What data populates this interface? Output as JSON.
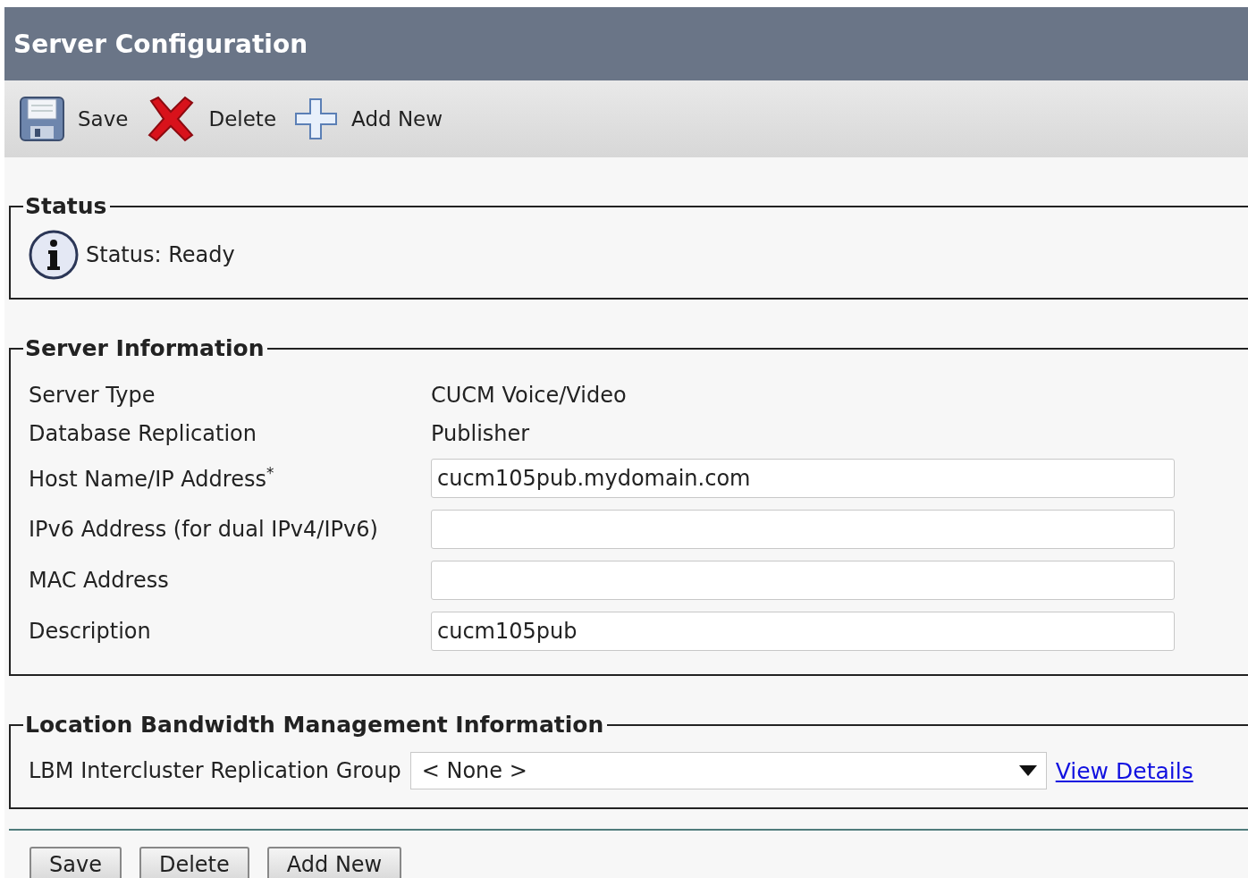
{
  "window": {
    "title": "Server Configuration"
  },
  "toolbar": [
    {
      "label": "Save",
      "kind": "save"
    },
    {
      "label": "Delete",
      "kind": "delete"
    },
    {
      "label": "Add New",
      "kind": "add"
    }
  ],
  "status": {
    "legend": "Status",
    "text": "Status: Ready"
  },
  "server_information": {
    "legend": "Server Information",
    "fields": [
      {
        "kind": "text",
        "label": "Server Type",
        "value": "CUCM Voice/Video"
      },
      {
        "kind": "text",
        "label": "Database Replication",
        "value": "Publisher"
      },
      {
        "kind": "input",
        "label": "Host Name/IP Address$^{*}$",
        "value": "cucm105pub.mydomain.com"
      },
      {
        "kind": "input",
        "label": "IPv6 Address (for dual IPv4/IPv6)"
      },
      {
        "kind": "input",
        "label": "MAC Address"
      },
      {
        "kind": "input",
        "label": "Description",
        "value": "cucm105pub"
      }
    ]
  },
  "lbm": {
    "legend": "Location Bandwidth Management Information",
    "label": "LBM Intercluster Replication Group",
    "value": "< None >",
    "link": "View Details"
  },
  "buttons": [
    "Save",
    "Delete",
    "Add New"
  ]
}
